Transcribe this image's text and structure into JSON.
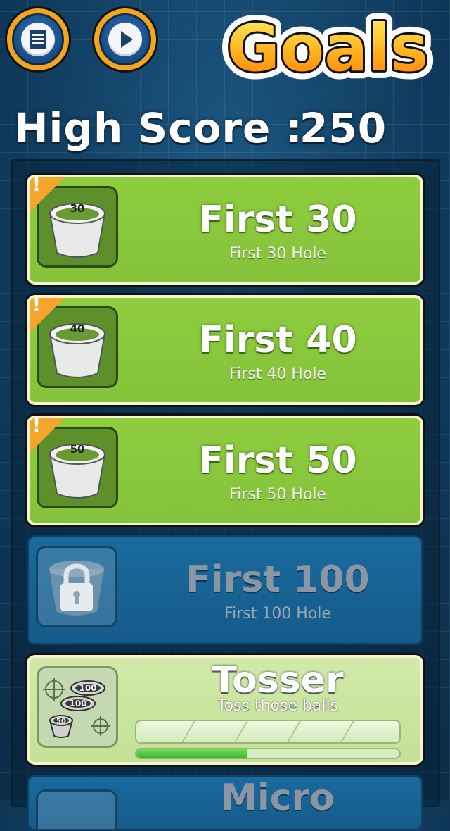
{
  "header": {
    "logo_text": "Goals",
    "menu_icon": "list-icon",
    "play_icon": "play-icon"
  },
  "high_score": {
    "label": "High Score :",
    "value": "250"
  },
  "goals": [
    {
      "title": "First 30",
      "subtitle": "First 30 Hole",
      "cup_label": "30",
      "state": "unlocked",
      "new_badge": "!"
    },
    {
      "title": "First 40",
      "subtitle": "First 40 Hole",
      "cup_label": "40",
      "state": "unlocked",
      "new_badge": "!"
    },
    {
      "title": "First 50",
      "subtitle": "First 50 Hole",
      "cup_label": "50",
      "state": "unlocked",
      "new_badge": "!"
    },
    {
      "title": "First 100",
      "subtitle": "First 100 Hole",
      "state": "locked"
    },
    {
      "title": "Tosser",
      "subtitle": "Toss those balls",
      "state": "in-progress",
      "progress_fraction": 0.42,
      "cup_labels": [
        "100",
        "100",
        "50"
      ]
    },
    {
      "title": "Micro",
      "state": "locked"
    }
  ],
  "colors": {
    "unlocked_card": "#8fcd3e",
    "locked_card": "#1a6a9e",
    "progress_card": "#d2eaa9",
    "badge": "#f4a52a",
    "button_ring": "#f5a51c",
    "progress_fill": "#3fb52f"
  }
}
